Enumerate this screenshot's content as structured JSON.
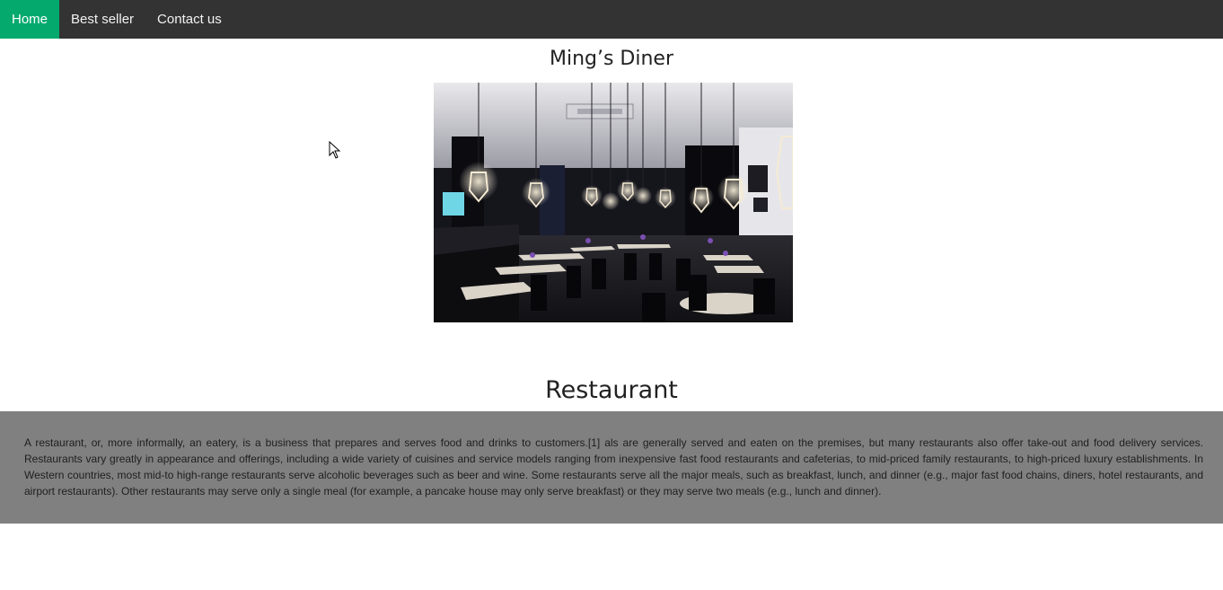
{
  "nav": {
    "items": [
      {
        "label": "Home",
        "active": true
      },
      {
        "label": "Best seller",
        "active": false
      },
      {
        "label": "Contact us",
        "active": false
      }
    ],
    "active_color": "#04aa6d",
    "bar_color": "#333333"
  },
  "header": {
    "title": "Ming’s Diner"
  },
  "hero_image": {
    "alt": "restaurant-interior-photo"
  },
  "section": {
    "title": "Restaurant",
    "body": "A restaurant, or, more informally, an eatery, is a business that prepares and serves food and drinks to customers.[1] als are generally served and eaten on the premises, but many restaurants also offer take-out and food delivery services. Restaurants vary greatly in appearance and offerings, including a wide variety of cuisines and service models ranging from inexpensive fast food restaurants and cafeterias, to mid-priced family restaurants, to high-priced luxury establishments. In Western countries, most mid-to high-range restaurants serve alcoholic beverages such as beer and wine. Some restaurants serve all the major meals, such as breakfast, lunch, and dinner (e.g., major fast food chains, diners, hotel restaurants, and airport restaurants). Other restaurants may serve only a single meal (for example, a pancake house may only serve breakfast) or they may serve two meals (e.g., lunch and dinner).",
    "band_color": "#808080"
  }
}
